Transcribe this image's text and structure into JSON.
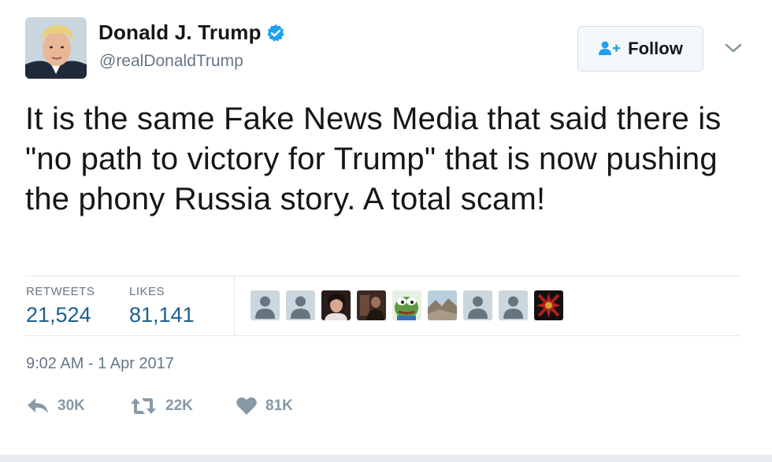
{
  "user": {
    "display_name": "Donald J. Trump",
    "handle": "@realDonaldTrump",
    "verified": true,
    "avatar_icon": "profile-photo",
    "verified_icon": "verified-badge-icon"
  },
  "header": {
    "follow_label": "Follow",
    "follow_icon": "add-user-icon",
    "menu_icon": "chevron-down-icon"
  },
  "tweet": {
    "text": "It is the same Fake News Media that said there is \"no path to victory for Trump\" that is now pushing the phony Russia story. A total scam!"
  },
  "stats": {
    "retweets_label": "RETWEETS",
    "retweets_value": "21,524",
    "likes_label": "LIKES",
    "likes_value": "81,141"
  },
  "likers": [
    {
      "type": "default-avatar"
    },
    {
      "type": "default-avatar"
    },
    {
      "type": "photo-woman"
    },
    {
      "type": "photo-dark"
    },
    {
      "type": "pepe-frog"
    },
    {
      "type": "landscape"
    },
    {
      "type": "default-avatar"
    },
    {
      "type": "default-avatar"
    },
    {
      "type": "red-cross-emblem"
    }
  ],
  "timestamp": "9:02 AM - 1 Apr 2017",
  "actions": {
    "reply": {
      "count": "30K",
      "icon": "reply-icon"
    },
    "retweet": {
      "count": "22K",
      "icon": "retweet-icon"
    },
    "like": {
      "count": "81K",
      "icon": "heart-icon"
    }
  },
  "colors": {
    "text_primary": "#14171a",
    "text_secondary": "#657786",
    "link_blue": "#1b5f8f",
    "verified_blue": "#1da1f2",
    "divider": "#e1e8ed",
    "action_gray": "#8899a6"
  }
}
